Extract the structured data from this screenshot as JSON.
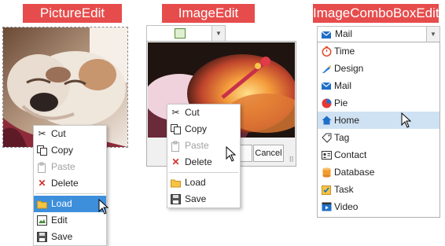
{
  "sections": {
    "picture_edit_title": "PictureEdit",
    "image_edit_title": "ImageEdit",
    "image_combo_title": "ImageComboBoxEdit"
  },
  "picture_edit": {
    "menu": {
      "cut": "Cut",
      "copy": "Copy",
      "paste": "Paste",
      "delete": "Delete",
      "load": "Load",
      "edit": "Edit",
      "save": "Save"
    }
  },
  "image_edit": {
    "popup": {
      "cancel_label": "Cancel"
    },
    "menu": {
      "cut": "Cut",
      "copy": "Copy",
      "paste": "Paste",
      "delete": "Delete",
      "load": "Load",
      "save": "Save"
    }
  },
  "image_combo": {
    "selected": "Mail",
    "items": [
      "Time",
      "Design",
      "Mail",
      "Pie",
      "Home",
      "Tag",
      "Contact",
      "Database",
      "Task",
      "Video"
    ]
  },
  "colors": {
    "banner": "#e74c4c",
    "menu_highlight": "#3d8fdc",
    "list_hover": "#cfe2f3"
  }
}
